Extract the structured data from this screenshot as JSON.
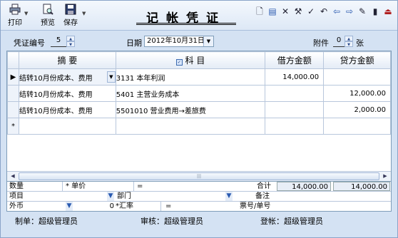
{
  "toolbar": {
    "print_label": "打印",
    "preview_label": "预览",
    "save_label": "保存",
    "title": "记帐凭证"
  },
  "header": {
    "voucher_no_label": "凭证编号",
    "voucher_no_value": "5",
    "date_label": "日期",
    "date_value": "2012年10月31日",
    "attach_label": "附件",
    "attach_value": "0",
    "attach_unit": "张"
  },
  "grid": {
    "columns": {
      "summary": "摘  要",
      "account": "科  目",
      "debit": "借方金额",
      "credit": "贷方金额"
    },
    "rows": [
      {
        "summary": "结转10月份成本、费用",
        "account": "3131 本年利润",
        "debit": "14,000.00",
        "credit": ""
      },
      {
        "summary": "结转10月份成本、费用",
        "account": "5401 主营业务成本",
        "debit": "",
        "credit": "12,000.00"
      },
      {
        "summary": "结转10月份成本、费用",
        "account": "5501010 营业费用→差旅费",
        "debit": "",
        "credit": "2,000.00"
      }
    ],
    "new_row_marker": "*"
  },
  "info": {
    "qty_label": "数量",
    "price_label": "* 单价",
    "eq": "=",
    "project_label": "项目",
    "dept_label": "部门",
    "currency_label": "外币",
    "currency_value": "0",
    "rate_label": "*汇率",
    "total_label": "合计",
    "total_debit": "14,000.00",
    "total_credit": "14,000.00",
    "remark_label": "备注",
    "ticket_label": "票号/单号"
  },
  "footer": {
    "maker": "制单：超级管理员",
    "auditor": "审核：超级管理员",
    "poster": "登帐：超级管理员"
  }
}
